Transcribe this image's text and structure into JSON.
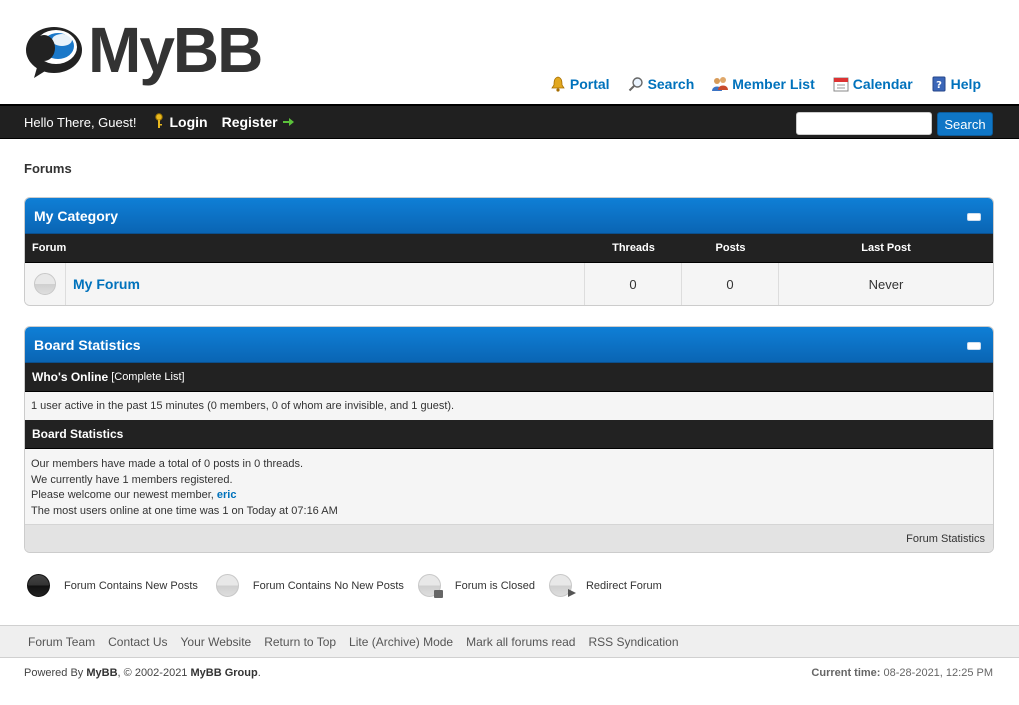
{
  "header": {
    "logo_text": "MyBB",
    "nav": [
      {
        "label": "Portal",
        "icon": "bell-icon"
      },
      {
        "label": "Search",
        "icon": "magnifier-icon"
      },
      {
        "label": "Member List",
        "icon": "members-icon"
      },
      {
        "label": "Calendar",
        "icon": "calendar-icon"
      },
      {
        "label": "Help",
        "icon": "help-icon"
      }
    ]
  },
  "panel": {
    "greeting": "Hello There, Guest!",
    "login": "Login",
    "register": "Register",
    "search_placeholder": "",
    "search_button": "Search"
  },
  "breadcrumb": "Forums",
  "category": {
    "title": "My Category",
    "columns": [
      "Forum",
      "Threads",
      "Posts",
      "Last Post"
    ],
    "forums": [
      {
        "name": "My Forum",
        "threads": "0",
        "posts": "0",
        "last_post": "Never"
      }
    ]
  },
  "stats": {
    "title": "Board Statistics",
    "whos_online": "Who's Online",
    "complete_list": "[Complete List]",
    "online_text": "1 user active in the past 15 minutes (0 members, 0 of whom are invisible, and 1 guest).",
    "section_title": "Board Statistics",
    "line1": "Our members have made a total of 0 posts in 0 threads.",
    "line2": "We currently have 1 members registered.",
    "line3_prefix": "Please welcome our newest member,",
    "newest_member": "eric",
    "line4": "The most users online at one time was 1 on Today at 07:16 AM",
    "footer_link": "Forum Statistics"
  },
  "legend": [
    {
      "label": "Forum Contains New Posts",
      "icon": "new-posts-icon"
    },
    {
      "label": "Forum Contains No New Posts",
      "icon": "no-new-posts-icon"
    },
    {
      "label": "Forum is Closed",
      "icon": "closed-forum-icon"
    },
    {
      "label": "Redirect Forum",
      "icon": "redirect-forum-icon"
    }
  ],
  "footer": {
    "links": [
      "Forum Team",
      "Contact Us",
      "Your Website",
      "Return to Top",
      "Lite (Archive) Mode",
      "Mark all forums read",
      "RSS Syndication"
    ],
    "powered_prefix": "Powered By",
    "powered_mybb": "MyBB",
    "powered_mid": ", © 2002-2021",
    "powered_group": "MyBB Group",
    "powered_suffix": ".",
    "current_time_label": "Current time:",
    "current_time": "08-28-2021, 12:25 PM"
  },
  "colors": {
    "accent": "#0072bc",
    "header_blue": "#0f7fd6",
    "dark_bar": "#202020"
  }
}
